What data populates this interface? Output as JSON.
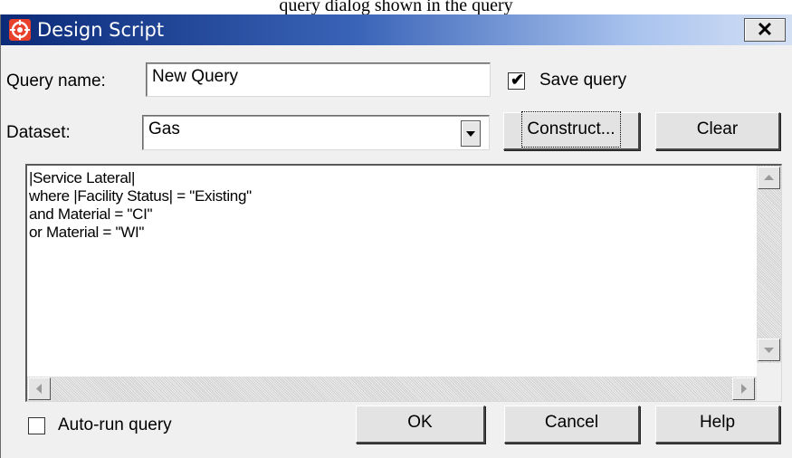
{
  "caption": {
    "text": "query dialog shown in the query"
  },
  "window": {
    "title": "Design Script",
    "close_glyph": "✕",
    "app_icon": "design-script-app-icon"
  },
  "query_name": {
    "label": "Query name:",
    "value": "New Query"
  },
  "save_query": {
    "label": "Save query",
    "checked": true
  },
  "dataset": {
    "label": "Dataset:",
    "value": "Gas"
  },
  "buttons": {
    "construct": "Construct...",
    "clear": "Clear",
    "ok": "OK",
    "cancel": "Cancel",
    "help": "Help"
  },
  "script": {
    "lines": [
      "|Service Lateral|",
      "where |Facility Status| = \"Existing\"",
      "and Material = \"CI\"",
      "or Material = \"WI\""
    ]
  },
  "auto_run": {
    "label": "Auto-run query",
    "checked": false
  },
  "icons": {
    "combo_arrow": "chevron-down-icon",
    "scroll_up": "arrow-up-icon",
    "scroll_down": "arrow-down-icon",
    "scroll_left": "arrow-left-icon",
    "scroll_right": "arrow-right-icon"
  }
}
